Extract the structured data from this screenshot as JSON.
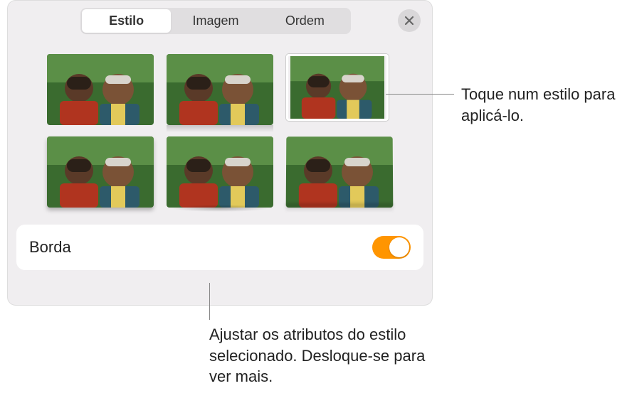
{
  "tabs": {
    "style": "Estilo",
    "image": "Imagem",
    "order": "Ordem"
  },
  "section": {
    "border_label": "Borda"
  },
  "callouts": {
    "top": "Toque num estilo para aplicá-lo.",
    "bottom": "Ajustar os atributos do estilo selecionado. Desloque-se para ver mais."
  }
}
